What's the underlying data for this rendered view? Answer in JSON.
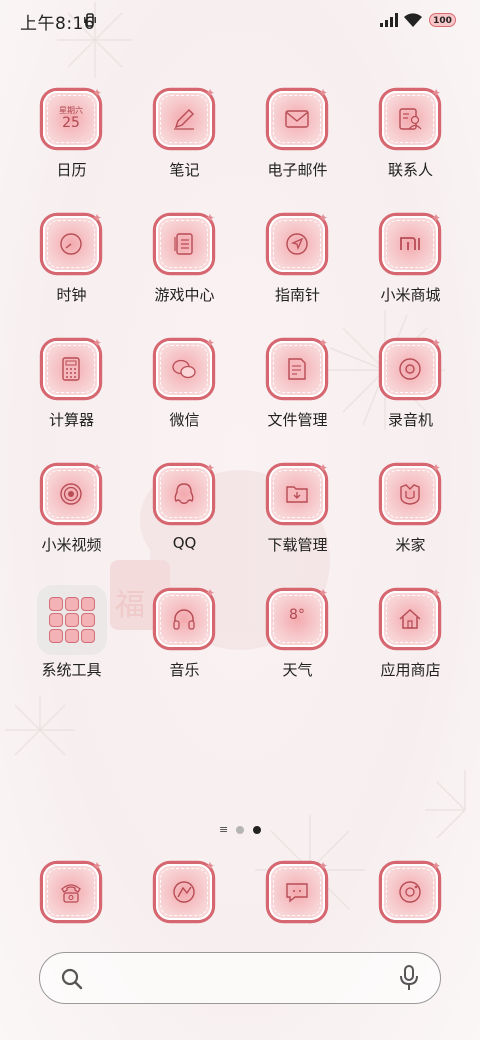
{
  "status_bar": {
    "time": "上午8:16",
    "battery": "100"
  },
  "apps": [
    {
      "label": "日历",
      "icon": "calendar-icon",
      "week": "星期六",
      "day": "25"
    },
    {
      "label": "笔记",
      "icon": "notes-pen-icon"
    },
    {
      "label": "电子邮件",
      "icon": "mail-icon"
    },
    {
      "label": "联系人",
      "icon": "contacts-icon"
    },
    {
      "label": "时钟",
      "icon": "clock-icon"
    },
    {
      "label": "游戏中心",
      "icon": "game-center-icon"
    },
    {
      "label": "指南针",
      "icon": "compass-icon"
    },
    {
      "label": "小米商城",
      "icon": "mi-store-icon"
    },
    {
      "label": "计算器",
      "icon": "calculator-icon"
    },
    {
      "label": "微信",
      "icon": "wechat-icon"
    },
    {
      "label": "文件管理",
      "icon": "file-manager-icon"
    },
    {
      "label": "录音机",
      "icon": "recorder-icon"
    },
    {
      "label": "小米视频",
      "icon": "video-icon"
    },
    {
      "label": "QQ",
      "icon": "qq-penguin-icon"
    },
    {
      "label": "下载管理",
      "icon": "download-folder-icon"
    },
    {
      "label": "米家",
      "icon": "mijia-icon"
    },
    {
      "label": "系统工具",
      "icon": "folder-icon"
    },
    {
      "label": "音乐",
      "icon": "headphones-icon"
    },
    {
      "label": "天气",
      "icon": "weather-icon",
      "temp": "8°"
    },
    {
      "label": "应用商店",
      "icon": "app-store-house-icon"
    }
  ],
  "dock": [
    {
      "icon": "phone-icon"
    },
    {
      "icon": "browser-icon"
    },
    {
      "icon": "messages-icon"
    },
    {
      "icon": "camera-icon"
    }
  ],
  "page_indicator": {
    "pages": 3,
    "current": 3
  },
  "colors": {
    "accent": "#d66770",
    "icon_fill": "#f3a9ae"
  }
}
